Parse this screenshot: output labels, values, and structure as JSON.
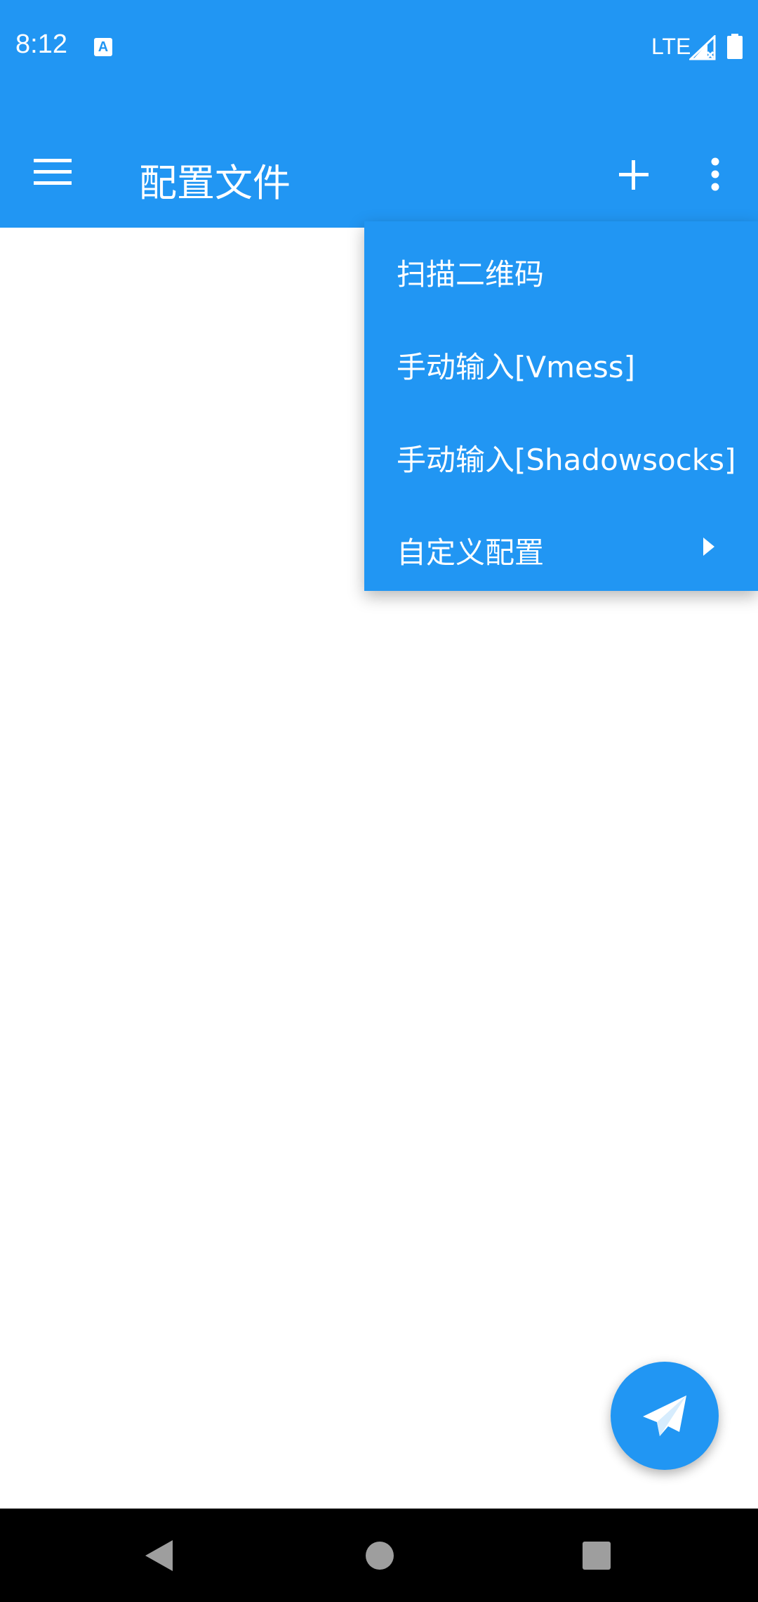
{
  "status_bar": {
    "time": "8:12",
    "network": "LTE",
    "notification_icon": "A",
    "icons": [
      "text-a-icon",
      "signal-icon",
      "battery-icon"
    ]
  },
  "app_bar": {
    "title": "配置文件",
    "icons": [
      "menu-icon",
      "add-icon",
      "more-vert-icon"
    ]
  },
  "dropdown_menu": {
    "items": [
      {
        "label": "扫描二维码"
      },
      {
        "label": "手动输入[Vmess]"
      },
      {
        "label": "手动输入[Shadowsocks]"
      },
      {
        "label": "自定义配置",
        "has_submenu": true
      }
    ]
  },
  "fab": {
    "icon": "send-icon"
  },
  "nav_bar": {
    "icons": [
      "back-icon",
      "home-icon",
      "recents-icon"
    ]
  },
  "colors": {
    "primary": "#2196F3",
    "background": "#ffffff",
    "nav_bar": "#000000"
  }
}
